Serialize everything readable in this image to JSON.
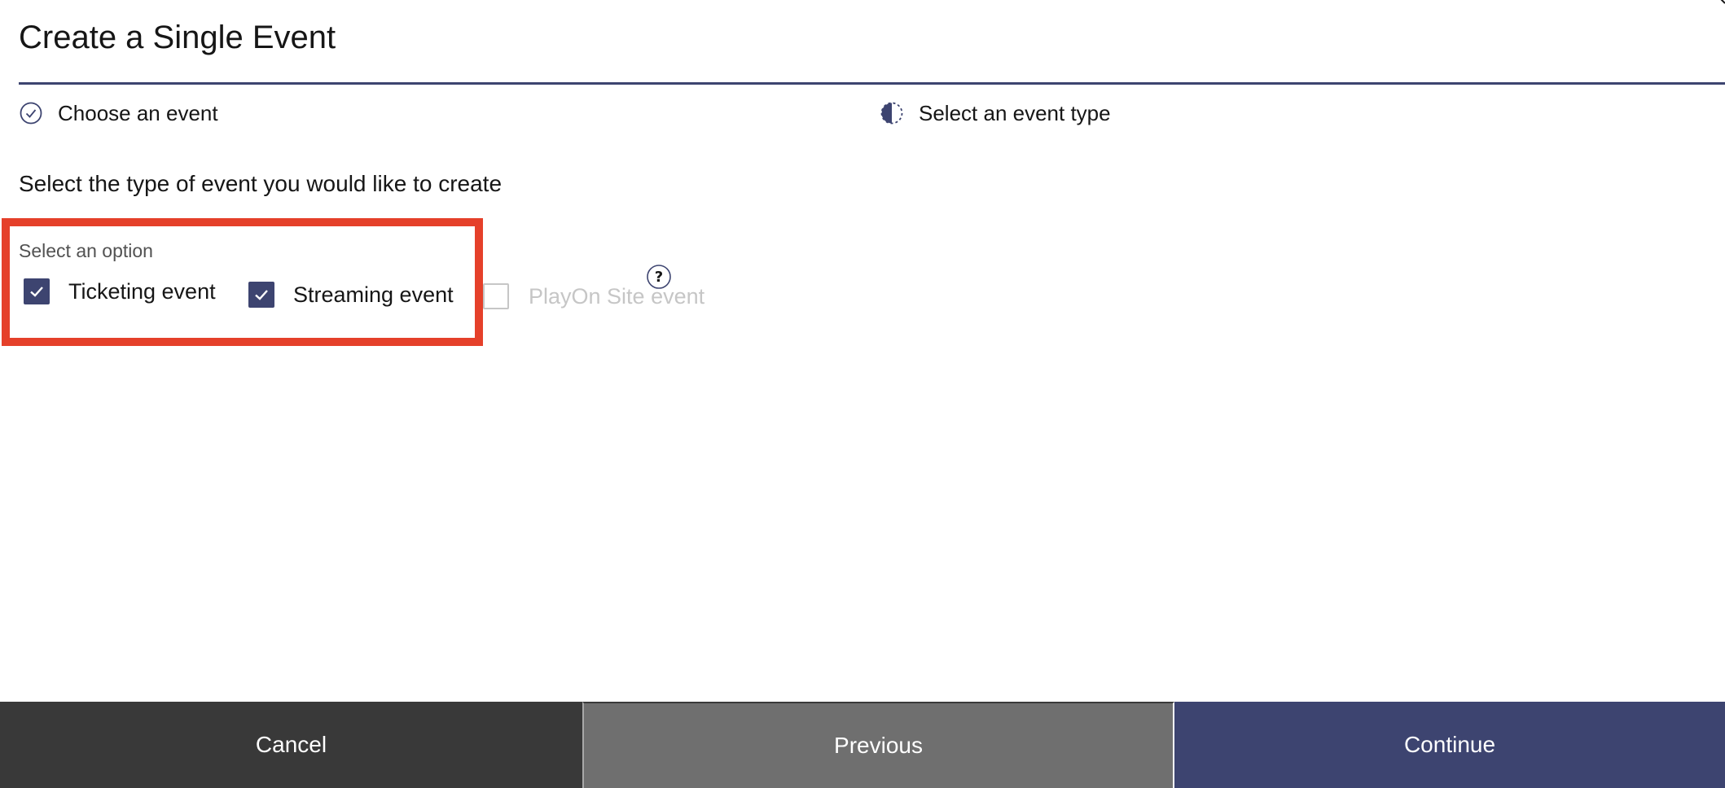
{
  "modal": {
    "title": "Create a Single Event"
  },
  "steps": [
    {
      "label": "Choose an event",
      "state": "complete"
    },
    {
      "label": "Select an event type",
      "state": "current"
    }
  ],
  "instruction": "Select the type of event you would like to create",
  "options_group": {
    "legend": "Select an option",
    "options": [
      {
        "label": "Ticketing event",
        "checked": true,
        "disabled": false
      },
      {
        "label": "Streaming event",
        "checked": true,
        "disabled": false
      },
      {
        "label": "PlayOn Site event",
        "checked": false,
        "disabled": true
      }
    ],
    "help_icon": "question-circle-icon"
  },
  "footer": {
    "cancel_label": "Cancel",
    "previous_label": "Previous",
    "continue_label": "Continue"
  },
  "colors": {
    "primary": "#3d4470",
    "highlight": "#e5402a",
    "cancel_bg": "#393939",
    "previous_bg": "#6f6f6f"
  }
}
